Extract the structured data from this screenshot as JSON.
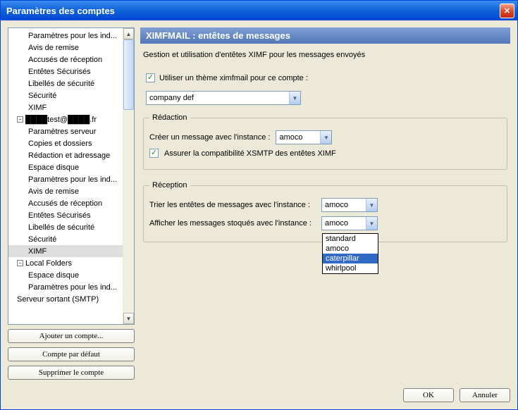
{
  "title": "Paramètres des comptes",
  "tree": {
    "items": [
      {
        "label": "Paramètres pour les ind...",
        "level": 2
      },
      {
        "label": "Avis de remise",
        "level": 2
      },
      {
        "label": "Accusés de réception",
        "level": 2
      },
      {
        "label": "Entêtes Sécurisés",
        "level": 2
      },
      {
        "label": "Libellés de sécurité",
        "level": 2
      },
      {
        "label": "Sécurité",
        "level": 2
      },
      {
        "label": "XIMF",
        "level": 2
      }
    ],
    "account_label": "████test@████.fr",
    "account_children": [
      {
        "label": "Paramètres serveur"
      },
      {
        "label": "Copies et dossiers"
      },
      {
        "label": "Rédaction et adressage"
      },
      {
        "label": "Espace disque"
      },
      {
        "label": "Paramètres pour les ind..."
      },
      {
        "label": "Avis de remise"
      },
      {
        "label": "Accusés de réception"
      },
      {
        "label": "Entêtes Sécurisés"
      },
      {
        "label": "Libellés de sécurité"
      },
      {
        "label": "Sécurité"
      },
      {
        "label": "XIMF"
      }
    ],
    "local_label": "Local Folders",
    "local_children": [
      {
        "label": "Espace disque"
      },
      {
        "label": "Paramètres pour les ind..."
      }
    ],
    "smtp_label": "Serveur sortant (SMTP)"
  },
  "buttons": {
    "add": "Ajouter un compte...",
    "default": "Compte par défaut",
    "delete": "Supprimer le compte"
  },
  "panel": {
    "title": "XIMFMAIL : entêtes de messages",
    "subtitle": "Gestion et utilisation d'entêtes XIMF pour les messages envoyés",
    "theme_check": "Utiliser un thème ximfmail pour ce compte :",
    "theme_value": "company def",
    "redaction": {
      "legend": "Rédaction",
      "create_label": "Créer un message avec l'instance :",
      "create_value": "amoco",
      "compat": "Assurer la compatibilité XSMTP des entêtes XIMF"
    },
    "reception": {
      "legend": "Réception",
      "sort_label": "Trier les entêtes de messages avec l'instance :",
      "sort_value": "amoco",
      "show_label": "Afficher les messages stoqués avec l'instance :",
      "show_value": "amoco",
      "options": [
        "standard",
        "amoco",
        "caterpillar",
        "whirlpool"
      ],
      "highlighted": "caterpillar"
    }
  },
  "footer": {
    "ok": "OK",
    "cancel": "Annuler"
  }
}
